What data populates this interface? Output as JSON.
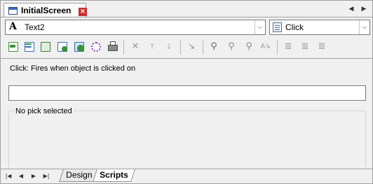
{
  "window": {
    "title": "InitialScreen",
    "close_glyph": "×",
    "nav_left_glyph": "◀",
    "nav_right_glyph": "▶"
  },
  "object_selector": {
    "icon": "text-object-icon",
    "glyph": "A",
    "value": "Text2",
    "dropdown_glyph": "⌵"
  },
  "event_selector": {
    "icon": "event-script-icon",
    "value": "Click",
    "dropdown_glyph": "⌵"
  },
  "toolbar": {
    "buttons": [
      {
        "name": "script-icon-1",
        "color": "#3a8f3a"
      },
      {
        "name": "script-icon-2",
        "color": "#3a8f3a"
      },
      {
        "name": "script-icon-3",
        "color": "#3a7a3a"
      },
      {
        "name": "script-icon-4",
        "color": "#2f6fb8"
      },
      {
        "name": "script-icon-5",
        "color": "#2f6fb8"
      },
      {
        "name": "script-icon-6",
        "color": "#8a3ab8"
      },
      {
        "name": "print-icon",
        "color": "#5a5a5a"
      }
    ],
    "delete_glyph": "✕",
    "move_up_glyph": "↑",
    "move_down_glyph": "↓",
    "goto_glyph": "↘",
    "find_glyph": "⚲",
    "find_next_glyph": "⚲",
    "replace_glyph": "⚲",
    "replace_all_glyph": "A↳",
    "comment_glyph": "≣",
    "uncomment_glyph": "≣",
    "toggle_glyph": "≣"
  },
  "content": {
    "description": "Click: Fires when object is clicked on",
    "script_value": "",
    "pick_label": "No pick selected"
  },
  "bottom_nav": {
    "first_glyph": "|◀",
    "prev_glyph": "◀",
    "next_glyph": "▶",
    "last_glyph": "▶|"
  },
  "tabs": [
    {
      "label": "Design",
      "active": false
    },
    {
      "label": "Scripts",
      "active": true
    }
  ],
  "colors": {
    "close_button": "#c9302c",
    "window_bg": "#f0f0f0"
  }
}
